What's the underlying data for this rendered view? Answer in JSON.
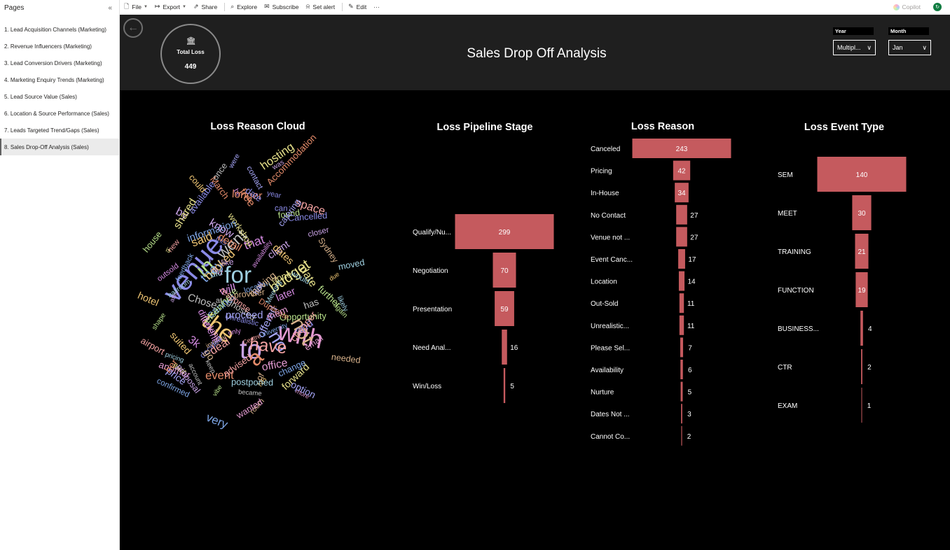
{
  "pages": {
    "header": "Pages",
    "collapse": "«",
    "items": [
      {
        "label": "1. Lead Acquisition Channels (Marketing)",
        "active": false
      },
      {
        "label": "2. Revenue Influencers (Marketing)",
        "active": false
      },
      {
        "label": "3. Lead Conversion Drivers (Marketing)",
        "active": false
      },
      {
        "label": "4. Marketing Enquiry Trends (Marketing)",
        "active": false
      },
      {
        "label": "5. Lead Source Value (Sales)",
        "active": false
      },
      {
        "label": "6. Location & Source Performance (Sales)",
        "active": false
      },
      {
        "label": "7. Leads Targeted Trend/Gaps (Sales)",
        "active": false
      },
      {
        "label": "8. Sales Drop-Off Analysis (Sales)",
        "active": true
      }
    ]
  },
  "toolbar": {
    "file": "File",
    "export": "Export",
    "share": "Share",
    "explore": "Explore",
    "subscribe": "Subscribe",
    "set_alert": "Set alert",
    "edit": "Edit",
    "more": "···",
    "copilot": "Copilot"
  },
  "report": {
    "title": "Sales Drop Off Analysis",
    "kpi": {
      "label": "Total Loss",
      "value": "449"
    },
    "slicers": {
      "year": {
        "label": "Year",
        "value": "Multipl..."
      },
      "month": {
        "label": "Month",
        "value": "Jan"
      }
    },
    "visual_titles": {
      "cloud": "Loss Reason Cloud",
      "stage": "Loss Pipeline Stage",
      "reason": "Loss Reason",
      "event": "Loss Event Type"
    }
  },
  "colors": {
    "bar": "#c55a5e",
    "background": "#000000",
    "header": "#1f1f1f",
    "text": "#ffffff"
  },
  "word_cloud": {
    "words": [
      "venue",
      "to",
      "with",
      "the",
      "for",
      "a",
      "in",
      "not",
      "no",
      "have",
      "went",
      "budget",
      "they",
      "that",
      "and",
      "client",
      "another",
      "NB",
      "pricing",
      "event",
      "found",
      "room",
      "contact",
      "space",
      "has",
      "their",
      "location",
      "different",
      "Cancelled",
      "was",
      "more",
      "dates",
      "Meeting",
      "Accommodation",
      "Opportunity",
      "internal",
      "offered",
      "cheaper",
      "ghosted",
      "workshop",
      "information",
      "availability",
      "Unrealistic",
      "proposal",
      "looking",
      "hotel",
      "moved",
      "March",
      "further",
      "needed",
      "price",
      "airport",
      "account",
      "forward",
      "feedback",
      "will",
      "this",
      "closer",
      "office",
      "booked",
      "postponed",
      "Duplicate",
      "house",
      "of",
      "were",
      "advised",
      "Chose",
      "date",
      "cannot",
      "be",
      "decided",
      "by",
      "out",
      "said",
      "did",
      "longer",
      "elsewhere",
      "Sydney",
      "catering",
      "deal",
      "keep",
      "shared",
      "change",
      "outsold",
      "available",
      "after",
      "them",
      "could",
      "likely",
      "free",
      "vibe",
      "go",
      "option",
      "Centre",
      "became",
      "gone",
      "University",
      "only",
      "can",
      "know",
      "wanted",
      "suited",
      "ballroom",
      "detail",
      "shape",
      "provider",
      "proceed",
      "response",
      "once",
      "hosting",
      "confirmed",
      "3k",
      "year",
      "like",
      "email",
      "due",
      "would",
      "her",
      "again",
      "moving",
      "half",
      "new",
      "at",
      "is",
      "very",
      "later",
      "date"
    ]
  },
  "chart_data": [
    {
      "type": "bar",
      "title": "Loss Pipeline Stage",
      "categories": [
        "Qualify/Nu...",
        "Negotiation",
        "Presentation",
        "Need Anal...",
        "Win/Loss"
      ],
      "values": [
        299,
        70,
        59,
        16,
        5
      ]
    },
    {
      "type": "bar",
      "title": "Loss Reason",
      "categories": [
        "Canceled",
        "Pricing",
        "In-House",
        "No Contact",
        "Venue not ...",
        "Event Canc...",
        "Location",
        "Out-Sold",
        "Unrealistic...",
        "Please Sel...",
        "Availability",
        "Nurture",
        "Dates Not ...",
        "Cannot Co..."
      ],
      "values": [
        243,
        42,
        34,
        27,
        27,
        17,
        14,
        11,
        11,
        7,
        6,
        5,
        3,
        2
      ]
    },
    {
      "type": "bar",
      "title": "Loss Event Type",
      "categories": [
        "SEM",
        "MEET",
        "TRAINING",
        "FUNCTION",
        "BUSINESS...",
        "CTR",
        "EXAM"
      ],
      "values": [
        140,
        30,
        21,
        19,
        4,
        2,
        1
      ]
    }
  ]
}
